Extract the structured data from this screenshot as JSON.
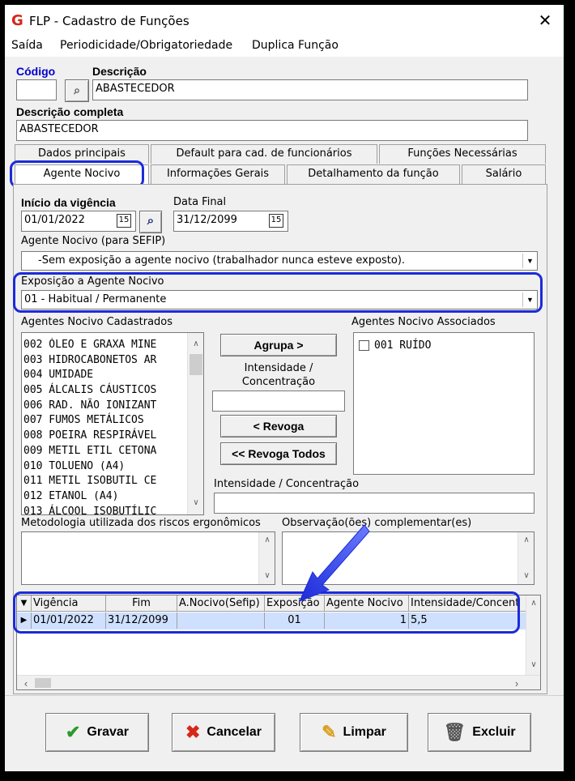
{
  "window": {
    "title": "FLP - Cadastro de Funções",
    "close_label": "✕",
    "app_icon": "G"
  },
  "menu": [
    "Saída",
    "Periodicidade/Obrigatoriedade",
    "Duplica Função"
  ],
  "header": {
    "codigo_label": "Código",
    "codigo_value": "",
    "descricao_label": "Descrição",
    "descricao_value": "ABASTECEDOR",
    "descricao_completa_label": "Descrição completa",
    "descricao_completa_value": "ABASTECEDOR"
  },
  "tabs": {
    "row1": [
      "Dados principais",
      "Default para cad. de funcionários",
      "Funções Necessárias"
    ],
    "row2": [
      "Agente Nocivo",
      "Informações Gerais",
      "Detalhamento da função",
      "Salário"
    ],
    "active": "Agente Nocivo"
  },
  "agente": {
    "inicio_label": "Início da vigência",
    "inicio_value": "01/01/2022",
    "data_final_label": "Data Final",
    "data_final_value": "31/12/2099",
    "sefip_label": "Agente Nocivo (para SEFIP)",
    "sefip_value": "-Sem exposição a agente nocivo (trabalhador nunca esteve exposto).",
    "exposicao_label": "Exposição a Agente Nocivo",
    "exposicao_value": "01 - Habitual / Permanente",
    "cadastrados_label": "Agentes Nocivo Cadastrados",
    "cadastrados": [
      "002 ÓLEO E GRAXA MINE",
      "003 HIDROCABONETOS AR",
      "004 UMIDADE",
      "005 ÁLCALIS CÁUSTICOS",
      "006 RAD. NÃO IONIZANT",
      "007 FUMOS METÁLICOS",
      "008 POEIRA RESPIRÁVEL",
      "009 METIL ETIL CETONA",
      "010 TOLUENO (A4)",
      "011 METIL ISOBUTIL CE",
      "012 ETANOL (A4)",
      "013 ÁLCOOL ISOBUTÍLIC"
    ],
    "associados_label": "Agentes Nocivo Associados",
    "associados": [
      "001 RUÍDO"
    ],
    "agrupa_label": "Agrupa >",
    "intensidade_label": "Intensidade / Concentração",
    "intensidade_value": "",
    "revoga_label": "< Revoga",
    "revoga_todos_label": "<< Revoga Todos",
    "intensidade2_label": "Intensidade /  Concentração",
    "intensidade2_value": "",
    "metodologia_label": "Metodologia utilizada dos riscos ergonômicos",
    "observacao_label": "Observação(ões) complementar(es)"
  },
  "grid": {
    "columns": [
      "Vigência",
      "Fim",
      "A.Nocivo(Sefip)",
      "Exposição",
      "Agente Nocivo",
      "Intensidade/Concent"
    ],
    "rows": [
      [
        "01/01/2022",
        "31/12/2099",
        "",
        "01",
        "1",
        "5,5"
      ]
    ]
  },
  "buttons": {
    "gravar": "Gravar",
    "cancelar": "Cancelar",
    "limpar": "Limpar",
    "excluir": "Excluir"
  },
  "colors": {
    "highlight": "#1c2bd9",
    "selected_row": "#cfe0ff",
    "app_icon": "#d62718"
  }
}
